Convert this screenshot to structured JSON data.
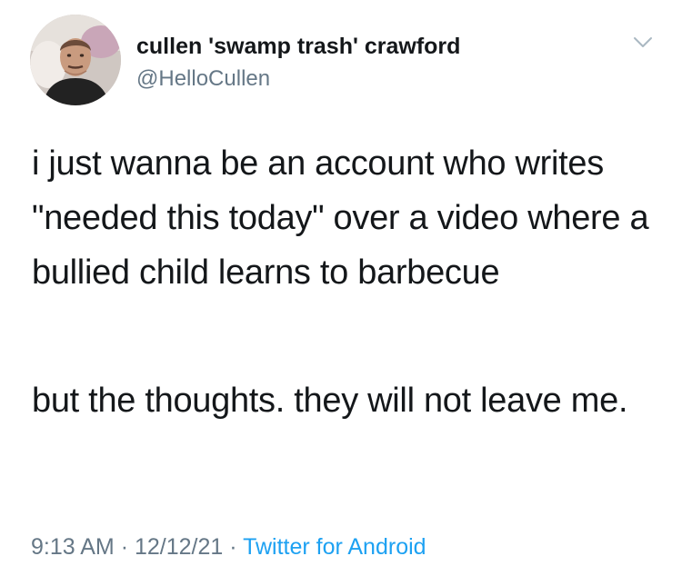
{
  "author": {
    "display_name": "cullen 'swamp trash' crawford",
    "handle": "@HelloCullen"
  },
  "tweet": {
    "paragraphs": [
      "i just wanna be an account who writes \"needed this today\" over a video where a bullied child learns to barbecue",
      "but the thoughts. they will not leave me."
    ]
  },
  "meta": {
    "time": "9:13 AM",
    "separator": "·",
    "date": "12/12/21",
    "source": "Twitter for Android"
  },
  "icons": {
    "menu": "chevron-down-icon",
    "avatar": "profile-photo"
  },
  "colors": {
    "text_primary": "#14171a",
    "text_secondary": "#657786",
    "link": "#1da1f2",
    "background": "#ffffff"
  }
}
